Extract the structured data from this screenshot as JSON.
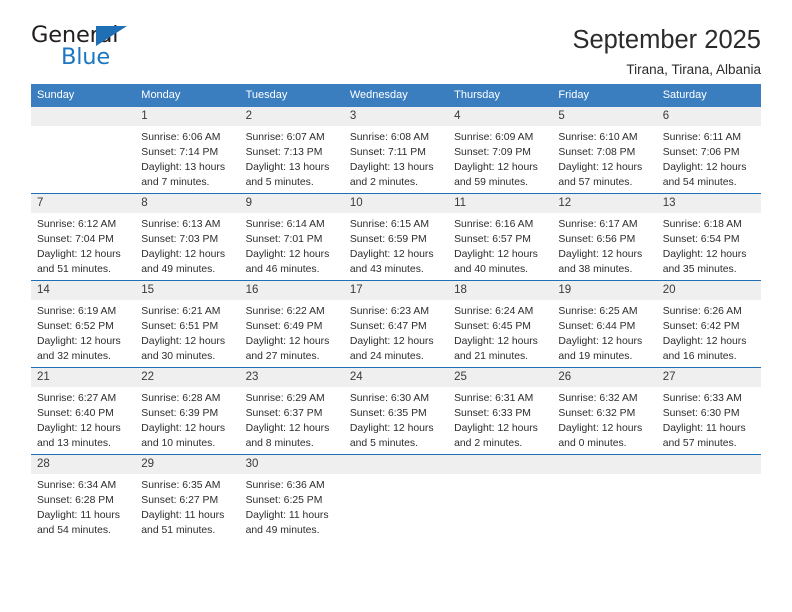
{
  "brand": {
    "name_part1": "General",
    "name_part2": "Blue",
    "triangle_color": "#1f6fb5",
    "blue_text_color": "#1c77c3"
  },
  "header": {
    "title": "September 2025",
    "subtitle": "Tirana, Tirana, Albania"
  },
  "theme": {
    "header_blue": "#3b7ec0",
    "rule_blue": "#1f6fb5",
    "daynum_band": "#efefef"
  },
  "calendar": {
    "day_headers": [
      "Sunday",
      "Monday",
      "Tuesday",
      "Wednesday",
      "Thursday",
      "Friday",
      "Saturday"
    ],
    "labels": {
      "sunrise": "Sunrise:",
      "sunset": "Sunset:",
      "daylight": "Daylight:"
    },
    "weeks": [
      [
        {
          "day": "",
          "empty": true
        },
        {
          "day": "1",
          "sunrise": "Sunrise: 6:06 AM",
          "sunset": "Sunset: 7:14 PM",
          "daylight_line1": "Daylight: 13 hours",
          "daylight_line2": "and 7 minutes."
        },
        {
          "day": "2",
          "sunrise": "Sunrise: 6:07 AM",
          "sunset": "Sunset: 7:13 PM",
          "daylight_line1": "Daylight: 13 hours",
          "daylight_line2": "and 5 minutes."
        },
        {
          "day": "3",
          "sunrise": "Sunrise: 6:08 AM",
          "sunset": "Sunset: 7:11 PM",
          "daylight_line1": "Daylight: 13 hours",
          "daylight_line2": "and 2 minutes."
        },
        {
          "day": "4",
          "sunrise": "Sunrise: 6:09 AM",
          "sunset": "Sunset: 7:09 PM",
          "daylight_line1": "Daylight: 12 hours",
          "daylight_line2": "and 59 minutes."
        },
        {
          "day": "5",
          "sunrise": "Sunrise: 6:10 AM",
          "sunset": "Sunset: 7:08 PM",
          "daylight_line1": "Daylight: 12 hours",
          "daylight_line2": "and 57 minutes."
        },
        {
          "day": "6",
          "sunrise": "Sunrise: 6:11 AM",
          "sunset": "Sunset: 7:06 PM",
          "daylight_line1": "Daylight: 12 hours",
          "daylight_line2": "and 54 minutes."
        }
      ],
      [
        {
          "day": "7",
          "sunrise": "Sunrise: 6:12 AM",
          "sunset": "Sunset: 7:04 PM",
          "daylight_line1": "Daylight: 12 hours",
          "daylight_line2": "and 51 minutes."
        },
        {
          "day": "8",
          "sunrise": "Sunrise: 6:13 AM",
          "sunset": "Sunset: 7:03 PM",
          "daylight_line1": "Daylight: 12 hours",
          "daylight_line2": "and 49 minutes."
        },
        {
          "day": "9",
          "sunrise": "Sunrise: 6:14 AM",
          "sunset": "Sunset: 7:01 PM",
          "daylight_line1": "Daylight: 12 hours",
          "daylight_line2": "and 46 minutes."
        },
        {
          "day": "10",
          "sunrise": "Sunrise: 6:15 AM",
          "sunset": "Sunset: 6:59 PM",
          "daylight_line1": "Daylight: 12 hours",
          "daylight_line2": "and 43 minutes."
        },
        {
          "day": "11",
          "sunrise": "Sunrise: 6:16 AM",
          "sunset": "Sunset: 6:57 PM",
          "daylight_line1": "Daylight: 12 hours",
          "daylight_line2": "and 40 minutes."
        },
        {
          "day": "12",
          "sunrise": "Sunrise: 6:17 AM",
          "sunset": "Sunset: 6:56 PM",
          "daylight_line1": "Daylight: 12 hours",
          "daylight_line2": "and 38 minutes."
        },
        {
          "day": "13",
          "sunrise": "Sunrise: 6:18 AM",
          "sunset": "Sunset: 6:54 PM",
          "daylight_line1": "Daylight: 12 hours",
          "daylight_line2": "and 35 minutes."
        }
      ],
      [
        {
          "day": "14",
          "sunrise": "Sunrise: 6:19 AM",
          "sunset": "Sunset: 6:52 PM",
          "daylight_line1": "Daylight: 12 hours",
          "daylight_line2": "and 32 minutes."
        },
        {
          "day": "15",
          "sunrise": "Sunrise: 6:21 AM",
          "sunset": "Sunset: 6:51 PM",
          "daylight_line1": "Daylight: 12 hours",
          "daylight_line2": "and 30 minutes."
        },
        {
          "day": "16",
          "sunrise": "Sunrise: 6:22 AM",
          "sunset": "Sunset: 6:49 PM",
          "daylight_line1": "Daylight: 12 hours",
          "daylight_line2": "and 27 minutes."
        },
        {
          "day": "17",
          "sunrise": "Sunrise: 6:23 AM",
          "sunset": "Sunset: 6:47 PM",
          "daylight_line1": "Daylight: 12 hours",
          "daylight_line2": "and 24 minutes."
        },
        {
          "day": "18",
          "sunrise": "Sunrise: 6:24 AM",
          "sunset": "Sunset: 6:45 PM",
          "daylight_line1": "Daylight: 12 hours",
          "daylight_line2": "and 21 minutes."
        },
        {
          "day": "19",
          "sunrise": "Sunrise: 6:25 AM",
          "sunset": "Sunset: 6:44 PM",
          "daylight_line1": "Daylight: 12 hours",
          "daylight_line2": "and 19 minutes."
        },
        {
          "day": "20",
          "sunrise": "Sunrise: 6:26 AM",
          "sunset": "Sunset: 6:42 PM",
          "daylight_line1": "Daylight: 12 hours",
          "daylight_line2": "and 16 minutes."
        }
      ],
      [
        {
          "day": "21",
          "sunrise": "Sunrise: 6:27 AM",
          "sunset": "Sunset: 6:40 PM",
          "daylight_line1": "Daylight: 12 hours",
          "daylight_line2": "and 13 minutes."
        },
        {
          "day": "22",
          "sunrise": "Sunrise: 6:28 AM",
          "sunset": "Sunset: 6:39 PM",
          "daylight_line1": "Daylight: 12 hours",
          "daylight_line2": "and 10 minutes."
        },
        {
          "day": "23",
          "sunrise": "Sunrise: 6:29 AM",
          "sunset": "Sunset: 6:37 PM",
          "daylight_line1": "Daylight: 12 hours",
          "daylight_line2": "and 8 minutes."
        },
        {
          "day": "24",
          "sunrise": "Sunrise: 6:30 AM",
          "sunset": "Sunset: 6:35 PM",
          "daylight_line1": "Daylight: 12 hours",
          "daylight_line2": "and 5 minutes."
        },
        {
          "day": "25",
          "sunrise": "Sunrise: 6:31 AM",
          "sunset": "Sunset: 6:33 PM",
          "daylight_line1": "Daylight: 12 hours",
          "daylight_line2": "and 2 minutes."
        },
        {
          "day": "26",
          "sunrise": "Sunrise: 6:32 AM",
          "sunset": "Sunset: 6:32 PM",
          "daylight_line1": "Daylight: 12 hours",
          "daylight_line2": "and 0 minutes."
        },
        {
          "day": "27",
          "sunrise": "Sunrise: 6:33 AM",
          "sunset": "Sunset: 6:30 PM",
          "daylight_line1": "Daylight: 11 hours",
          "daylight_line2": "and 57 minutes."
        }
      ],
      [
        {
          "day": "28",
          "sunrise": "Sunrise: 6:34 AM",
          "sunset": "Sunset: 6:28 PM",
          "daylight_line1": "Daylight: 11 hours",
          "daylight_line2": "and 54 minutes."
        },
        {
          "day": "29",
          "sunrise": "Sunrise: 6:35 AM",
          "sunset": "Sunset: 6:27 PM",
          "daylight_line1": "Daylight: 11 hours",
          "daylight_line2": "and 51 minutes."
        },
        {
          "day": "30",
          "sunrise": "Sunrise: 6:36 AM",
          "sunset": "Sunset: 6:25 PM",
          "daylight_line1": "Daylight: 11 hours",
          "daylight_line2": "and 49 minutes."
        },
        {
          "day": "",
          "empty": true
        },
        {
          "day": "",
          "empty": true
        },
        {
          "day": "",
          "empty": true
        },
        {
          "day": "",
          "empty": true
        }
      ]
    ]
  }
}
